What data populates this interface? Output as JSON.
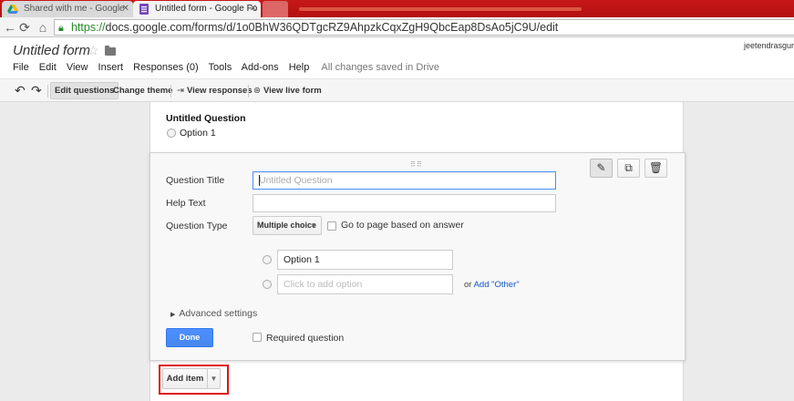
{
  "browser": {
    "tabs": [
      {
        "label": "Shared with me - Google",
        "icon": "google-drive-icon"
      },
      {
        "label": "Untitled form - Google Fo",
        "icon": "google-forms-icon"
      }
    ],
    "address": {
      "scheme": "https://",
      "host_path": "docs.google.com/forms/d/1o0BhW36QDTgcRZ9AhpzkCqxZgH9QbcEap8DsAo5jC9U/edit"
    }
  },
  "doc": {
    "title": "Untitled form",
    "user": "jeetendrasgur",
    "menu": [
      "File",
      "Edit",
      "View",
      "Insert",
      "Responses (0)",
      "Tools",
      "Add-ons",
      "Help"
    ],
    "saved_status": "All changes saved in Drive"
  },
  "toolbar": {
    "edit_questions": "Edit questions",
    "change_theme": "Change theme",
    "view_responses": "View responses",
    "view_live_form": "View live form"
  },
  "preview": {
    "question_title": "Untitled Question",
    "option": "Option 1"
  },
  "editor": {
    "question_title_label": "Question Title",
    "question_title_placeholder": "Untitled Question",
    "help_text_label": "Help Text",
    "question_type_label": "Question Type",
    "question_type_value": "Multiple choice",
    "go_to_page_label": "Go to page based on answer",
    "option1_value": "Option 1",
    "add_option_placeholder": "Click to add option",
    "or_text": "or",
    "add_other_link": "Add \"Other\"",
    "advanced_settings": "Advanced settings",
    "done_label": "Done",
    "required_label": "Required question"
  },
  "add_item": {
    "label": "Add item"
  },
  "colors": {
    "accent": "#4d90fe",
    "highlight_box": "#dd1111",
    "tabstrip": "#c81818"
  }
}
